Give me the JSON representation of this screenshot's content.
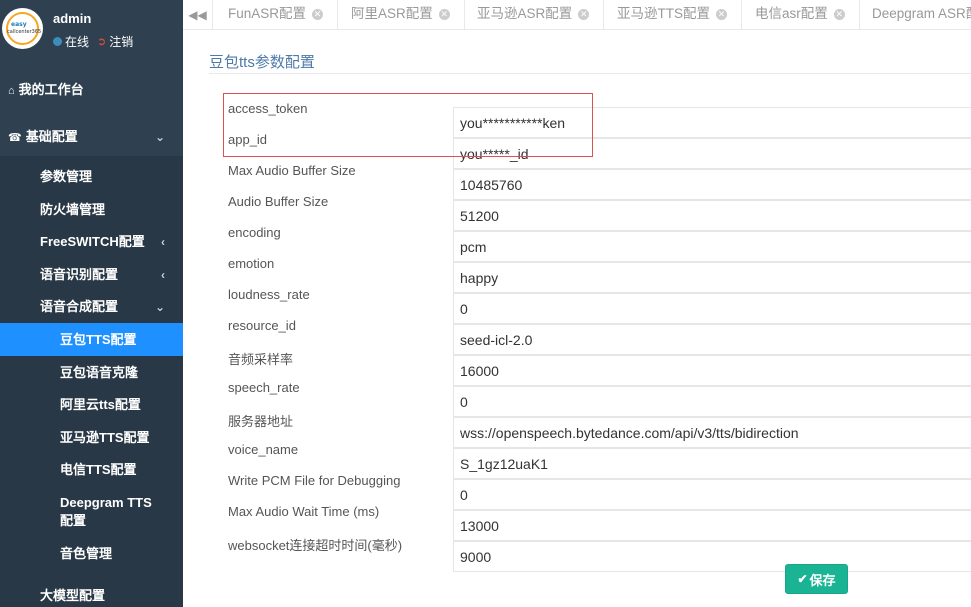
{
  "user": {
    "name": "admin",
    "status": "在线",
    "logout": "注销",
    "logo_line1": "easy",
    "logo_line2": "callcenter365"
  },
  "sidebar": {
    "workspace": "我的工作台",
    "basic_config": "基础配置",
    "items": [
      {
        "label": "参数管理"
      },
      {
        "label": "防火墙管理"
      },
      {
        "label": "FreeSWITCH配置"
      },
      {
        "label": "语音识别配置"
      },
      {
        "label": "语音合成配置"
      }
    ],
    "tts_items": [
      {
        "label": "豆包TTS配置"
      },
      {
        "label": "豆包语音克隆"
      },
      {
        "label": "阿里云tts配置"
      },
      {
        "label": "亚马逊TTS配置"
      },
      {
        "label": "电信TTS配置"
      },
      {
        "label": "Deepgram TTS"
      },
      {
        "label": "配置"
      },
      {
        "label": "音色管理"
      }
    ],
    "llm_config": "大模型配置"
  },
  "tabs": [
    {
      "label": "FunASR配置"
    },
    {
      "label": "阿里ASR配置"
    },
    {
      "label": "亚马逊ASR配置"
    },
    {
      "label": "亚马逊TTS配置"
    },
    {
      "label": "电信asr配置"
    },
    {
      "label": "Deepgram ASR配"
    }
  ],
  "page": {
    "title": "豆包tts参数配置",
    "save_label": "保存"
  },
  "fields": [
    {
      "label": "access_token",
      "value": "you***********ken"
    },
    {
      "label": "app_id",
      "value": "you*****_id"
    },
    {
      "label": "Max Audio Buffer Size",
      "value": "10485760"
    },
    {
      "label": "Audio Buffer Size",
      "value": "51200"
    },
    {
      "label": "encoding",
      "value": "pcm"
    },
    {
      "label": "emotion",
      "value": "happy"
    },
    {
      "label": "loudness_rate",
      "value": "0"
    },
    {
      "label": "resource_id",
      "value": "seed-icl-2.0"
    },
    {
      "label": "音频采样率",
      "value": "16000"
    },
    {
      "label": "speech_rate",
      "value": "0"
    },
    {
      "label": "服务器地址",
      "value": "wss://openspeech.bytedance.com/api/v3/tts/bidirection"
    },
    {
      "label": "voice_name",
      "value": "S_1gz12uaK1"
    },
    {
      "label": "Write PCM File for Debugging",
      "value": "0"
    },
    {
      "label": "Max Audio Wait Time (ms)",
      "value": "13000"
    },
    {
      "label": "websocket连接超时时间(毫秒)",
      "value": "9000"
    }
  ],
  "colors": {
    "sidebar_bg": "#2f4050",
    "active_item": "#1e90ff",
    "save_button": "#1ab394",
    "highlight_box": "#d9534f",
    "title": "#4d7aa9"
  }
}
